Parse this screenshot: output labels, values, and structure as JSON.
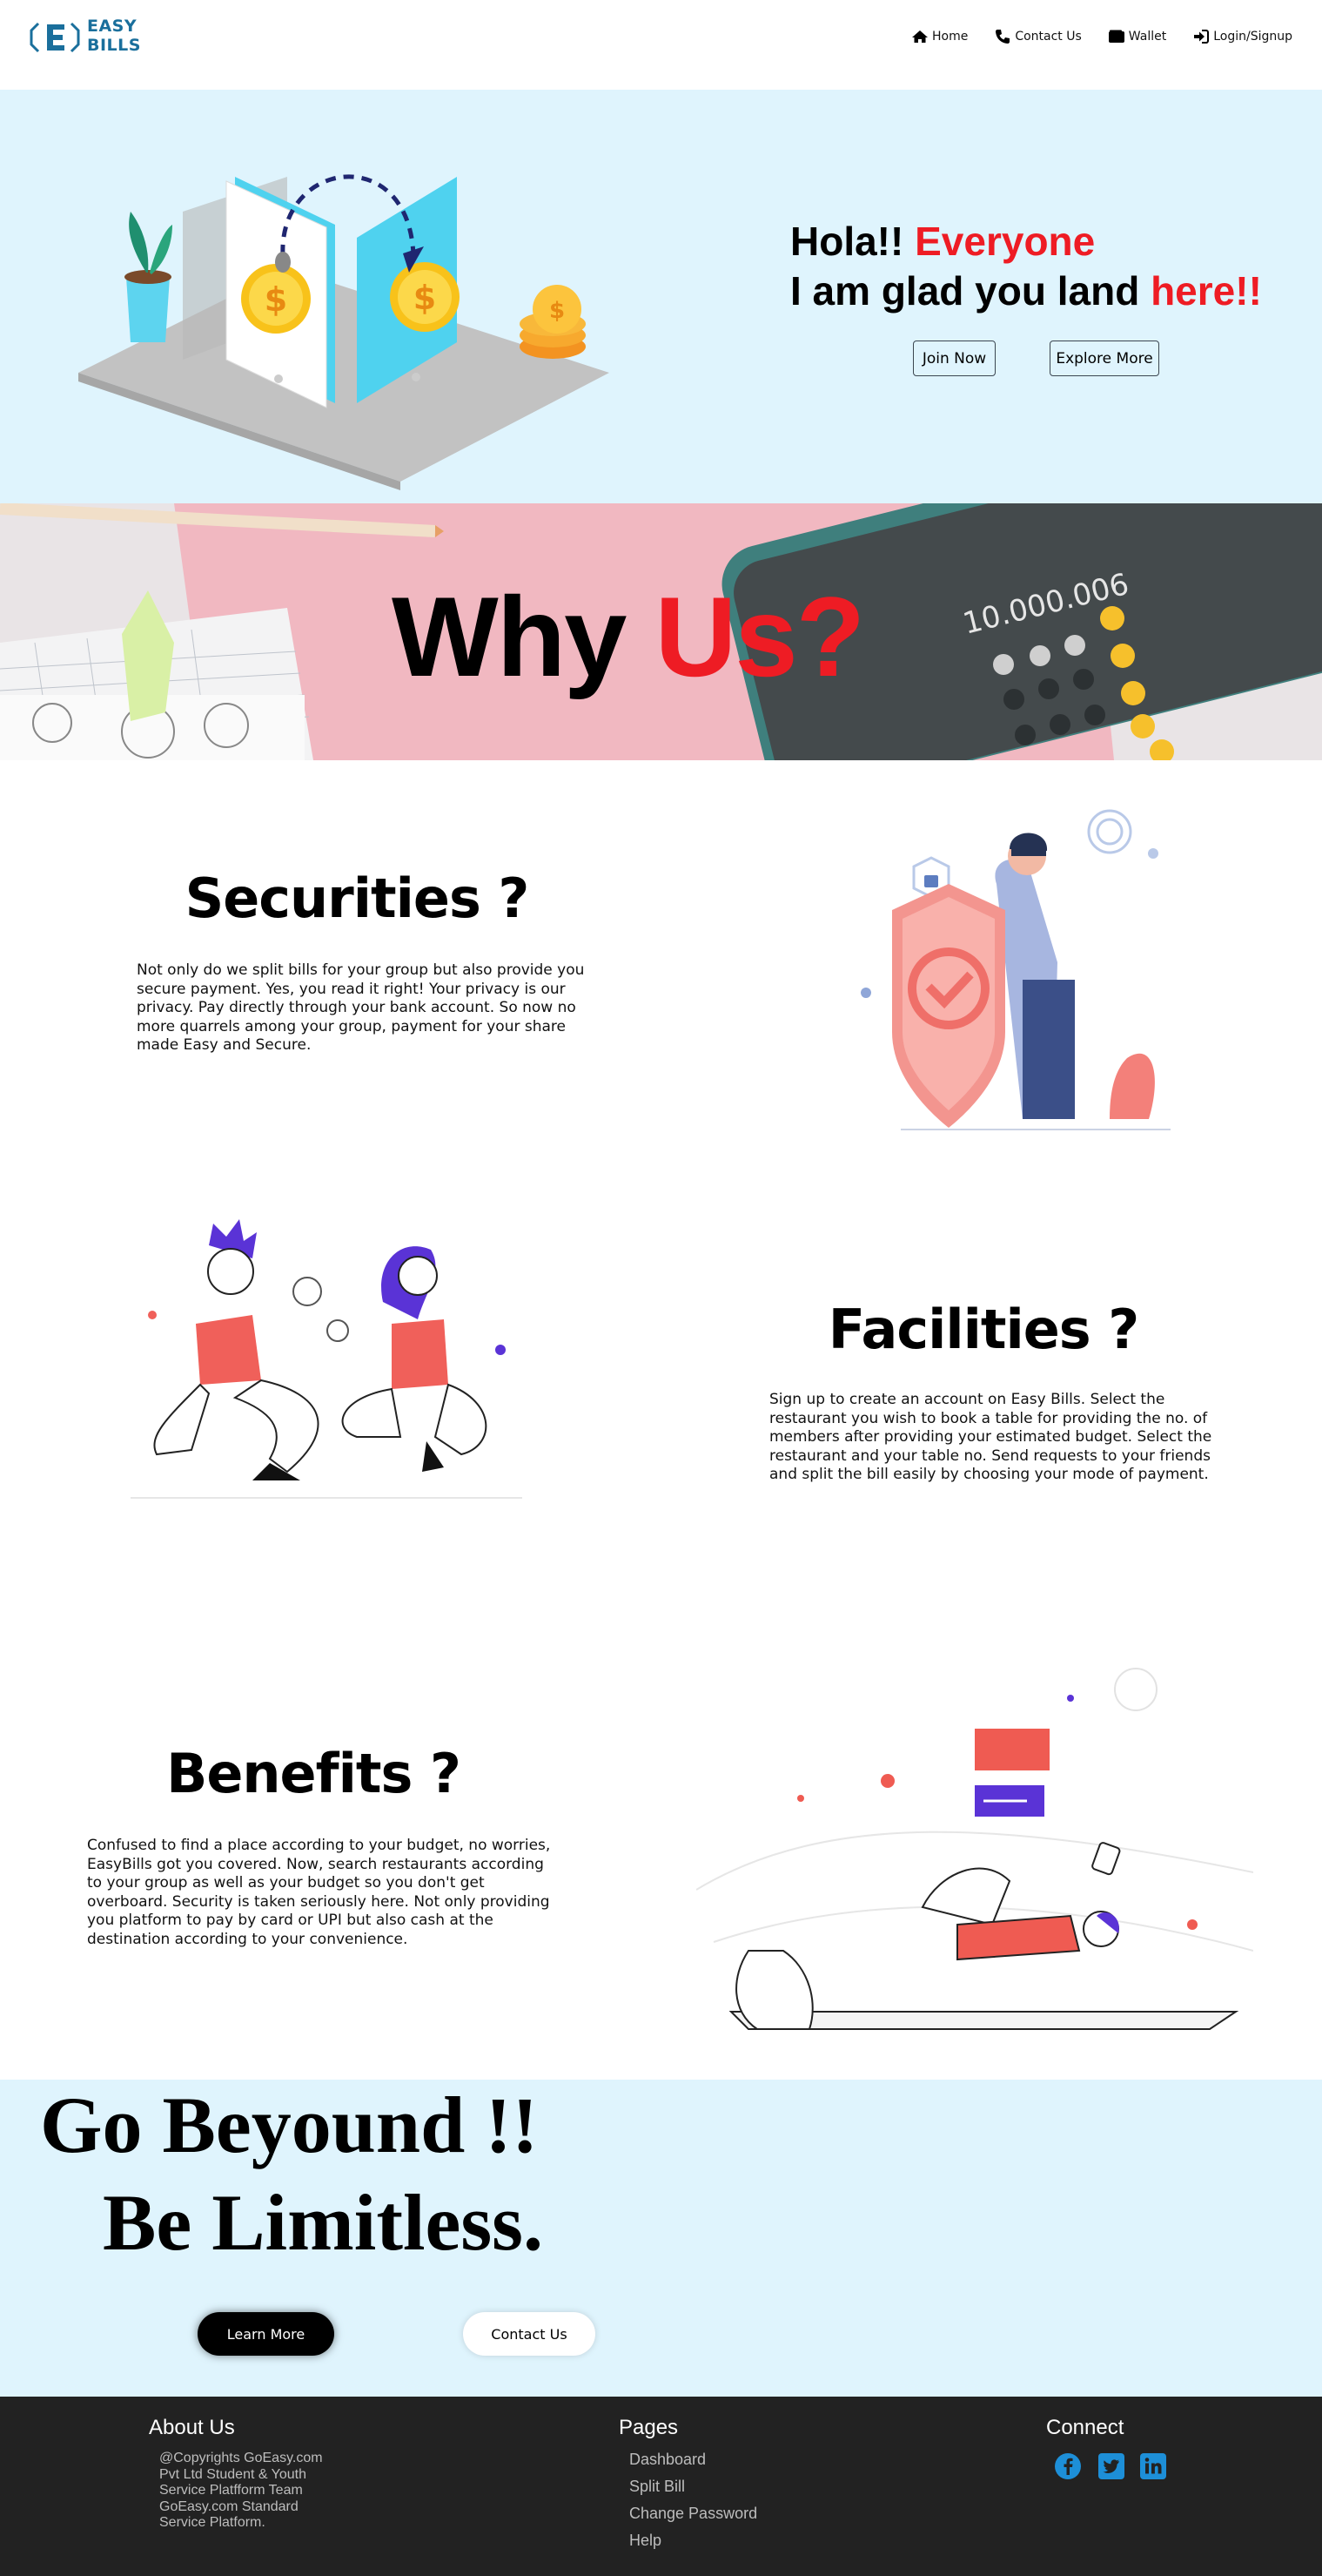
{
  "nav": {
    "logo_line1": "EASY",
    "logo_line2": "BILLS",
    "items": [
      {
        "label": "Home",
        "icon": "home-icon"
      },
      {
        "label": "Contact Us",
        "icon": "phone-icon"
      },
      {
        "label": "Wallet",
        "icon": "wallet-icon"
      },
      {
        "label": "Login/Signup",
        "icon": "sign-in-icon"
      }
    ]
  },
  "hero": {
    "line1_a": "Hola!! ",
    "line1_b": "Everyone",
    "line2_a": "I am glad you land ",
    "line2_b": "here!!",
    "join_label": "Join Now",
    "explore_label": "Explore More"
  },
  "why": {
    "title_a": "Why ",
    "title_b": "Us?",
    "calc_display": "10.000.006"
  },
  "securities": {
    "title": "Securities ?",
    "text": "Not only do we split bills for your group but also provide you secure payment. Yes, you read it right! Your privacy is our privacy. Pay directly through your bank account. So now no more quarrels among your group, payment for your share made Easy and Secure."
  },
  "facilities": {
    "title": "Facilities ?",
    "text": "Sign up to create an account on Easy Bills. Select the restaurant you wish to book a table for providing the no. of members after providing your estimated budget. Select the restaurant and your table no. Send requests to your friends and split the bill easily by choosing your mode of payment."
  },
  "benefits": {
    "title": "Benefits ?",
    "text": "Confused to find a place according to your budget, no worries, EasyBills got you covered. Now, search restaurants according to your group as well as your budget so you don't get overboard. Security is taken seriously here. Not only providing you platform to pay by card or UPI but also cash at the destination according to your convenience."
  },
  "beyond": {
    "line1": "Go Beyound !!",
    "line2": "Be Limitless.",
    "learn_label": "Learn More",
    "contact_label": "Contact Us"
  },
  "footer": {
    "about_title": "About Us",
    "about_text": "@Copyrights GoEasy.com Pvt Ltd Student & Youth Service Platfform Team GoEasy.com Standard Service Platform.",
    "pages_title": "Pages",
    "pages": [
      "Dashboard",
      "Split Bill",
      "Change Password",
      "Help"
    ],
    "connect_title": "Connect",
    "social_color": "#1d8fd8",
    "social": [
      "facebook-icon",
      "twitter-icon",
      "linkedin-icon"
    ]
  }
}
